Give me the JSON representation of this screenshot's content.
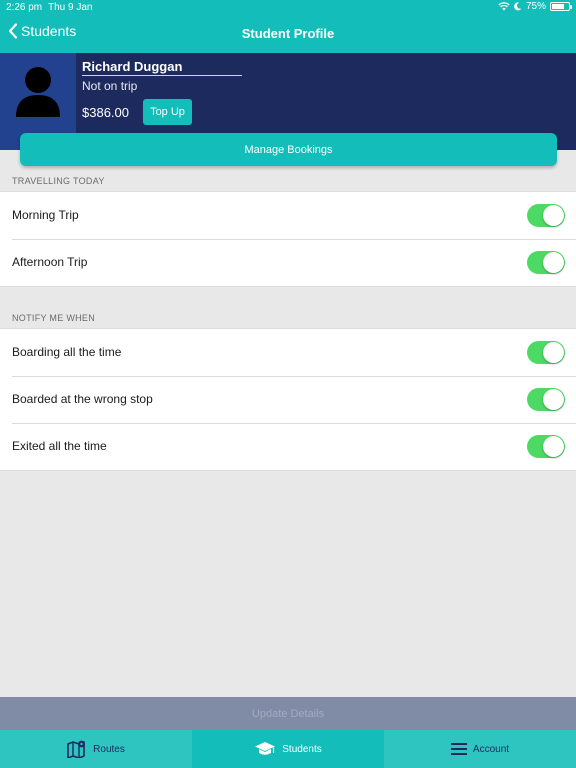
{
  "status_bar": {
    "time": "2:26 pm",
    "date": "Thu 9 Jan",
    "battery": "75%",
    "battery_level": 0.75
  },
  "nav": {
    "back_label": "Students",
    "title": "Student Profile"
  },
  "profile": {
    "name": "Richard Duggan",
    "status": "Not on trip",
    "balance": "$386.00",
    "topup_label": "Top Up",
    "manage_label": "Manage Bookings"
  },
  "travelling": {
    "header": "TRAVELLING TODAY",
    "items": [
      {
        "label": "Morning Trip",
        "enabled": true
      },
      {
        "label": "Afternoon Trip",
        "enabled": true
      }
    ]
  },
  "notify": {
    "header": "NOTIFY ME WHEN",
    "items": [
      {
        "label": "Boarding all the time",
        "enabled": true
      },
      {
        "label": "Boarded at the wrong stop",
        "enabled": true
      },
      {
        "label": "Exited all the time",
        "enabled": true
      }
    ]
  },
  "update_label": "Update Details",
  "tabs": [
    {
      "label": "Routes",
      "icon": "map-icon",
      "active": false
    },
    {
      "label": "Students",
      "icon": "graduation-cap-icon",
      "active": true
    },
    {
      "label": "Account",
      "icon": "menu-icon",
      "active": false
    }
  ],
  "colors": {
    "teal": "#13bdb9",
    "navy": "#1d2a5e",
    "toggle_on": "#4cd964"
  }
}
